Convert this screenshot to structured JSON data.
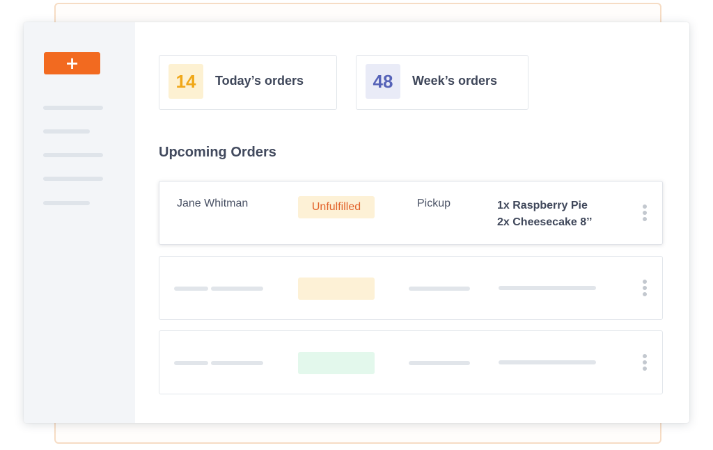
{
  "sidebar": {
    "add_button_label": "+",
    "accent": "#f26a20"
  },
  "stats": [
    {
      "value": "14",
      "label": "Today’s orders",
      "color": "#f0a81a",
      "bg": "#fdf1d2"
    },
    {
      "value": "48",
      "label": "Week’s orders",
      "color": "#5663b8",
      "bg": "#e9ebf7"
    }
  ],
  "section_title": "Upcoming Orders",
  "orders": [
    {
      "customer": "Jane Whitman",
      "status": "Unfulfilled",
      "method": "Pickup",
      "items": [
        "1x Raspberry Pie",
        "2x Cheesecake 8’’"
      ]
    }
  ],
  "placeholder_badge_colors": [
    "#fdf1d6",
    "#e3f8ec"
  ]
}
